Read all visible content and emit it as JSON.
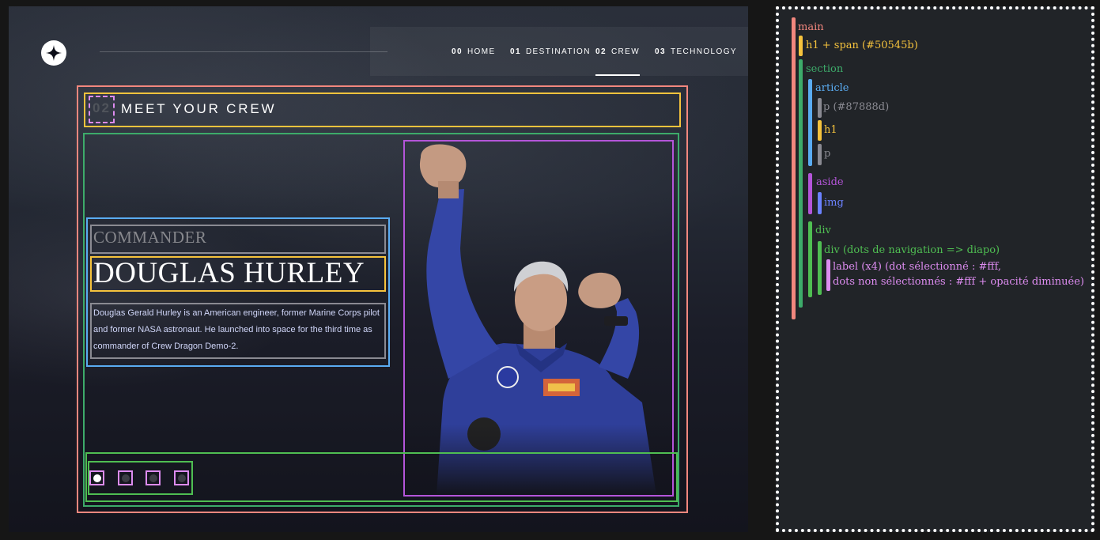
{
  "site": {
    "nav": [
      {
        "num": "00",
        "label": "HOME",
        "active": false
      },
      {
        "num": "01",
        "label": "DESTINATION",
        "active": false
      },
      {
        "num": "02",
        "label": "CREW",
        "active": true
      },
      {
        "num": "03",
        "label": "TECHNOLOGY",
        "active": false
      }
    ],
    "heading": {
      "number": "02",
      "text": "MEET YOUR CREW"
    },
    "crew": {
      "role": "COMMANDER",
      "name": "DOUGLAS HURLEY",
      "bio": "Douglas Gerald Hurley is an American engineer, former Marine Corps pilot and former NASA astronaut. He launched into space for the third time as commander of Crew Dragon Demo-2."
    },
    "slider": {
      "count": 4,
      "selected_index": 0
    }
  },
  "legend": {
    "main": "main",
    "h1_span": "h1 + span (#50545b)",
    "section": "section",
    "article": "article",
    "p_role": "p (#87888d)",
    "h1": "h1",
    "p": "p",
    "aside": "aside",
    "img": "img",
    "div": "div",
    "div_dots": "div (dots de navigation => diapo)",
    "label_line1": "label (x4) (dot sélectionné : #fff,",
    "label_line2": "dots non sélectionnés : #fff + opacité diminuée)"
  },
  "colors": {
    "main": "#f2877e",
    "heading": "#f6c33d",
    "section": "#3dab6a",
    "article": "#5aacf2",
    "paragraph": "#8a8a92",
    "aside": "#b455d9",
    "img": "#6b82ff",
    "div": "#4fbe52",
    "label": "#dd8cf0",
    "span_text": "#50545b",
    "role_text": "#87888d"
  },
  "icons": {
    "logo": "compass-star-icon"
  }
}
